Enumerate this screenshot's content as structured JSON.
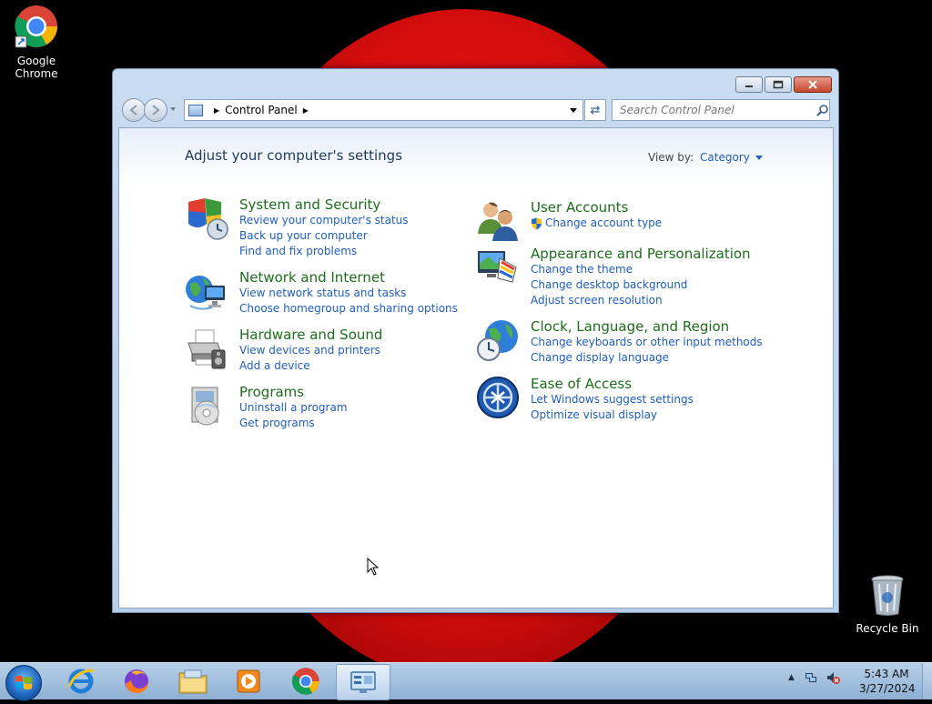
{
  "desktop": {
    "icons": [
      {
        "label_line1": "Google",
        "label_line2": "Chrome",
        "icon": "chrome-icon"
      },
      {
        "label": "Recycle Bin",
        "icon": "recycle-bin-icon"
      }
    ]
  },
  "window": {
    "address": {
      "breadcrumb": "Control Panel",
      "icon": "control-panel-icon"
    },
    "search": {
      "placeholder": "Search Control Panel"
    },
    "page_title": "Adjust your computer's settings",
    "view_by": {
      "label": "View by:",
      "value": "Category"
    },
    "categories": [
      {
        "title": "System and Security",
        "icon": "shield-icon",
        "links": [
          "Review your computer's status",
          "Back up your computer",
          "Find and fix problems"
        ]
      },
      {
        "title": "Network and Internet",
        "icon": "network-icon",
        "links": [
          "View network status and tasks",
          "Choose homegroup and sharing options"
        ]
      },
      {
        "title": "Hardware and Sound",
        "icon": "printer-icon",
        "links": [
          "View devices and printers",
          "Add a device"
        ]
      },
      {
        "title": "Programs",
        "icon": "programs-icon",
        "links": [
          "Uninstall a program",
          "Get programs"
        ]
      },
      {
        "title": "User Accounts",
        "icon": "users-icon",
        "links": [
          "Change account type"
        ]
      },
      {
        "title": "Appearance and Personalization",
        "icon": "monitor-palette-icon",
        "links": [
          "Change the theme",
          "Change desktop background",
          "Adjust screen resolution"
        ]
      },
      {
        "title": "Clock, Language, and Region",
        "icon": "globe-clock-icon",
        "links": [
          "Change keyboards or other input methods",
          "Change display language"
        ]
      },
      {
        "title": "Ease of Access",
        "icon": "ease-of-access-icon",
        "links": [
          "Let Windows suggest settings",
          "Optimize visual display"
        ]
      }
    ]
  },
  "taskbar": {
    "items": [
      "internet-explorer-icon",
      "firefox-icon",
      "file-explorer-icon",
      "media-player-icon",
      "chrome-icon",
      "control-panel-icon"
    ],
    "clock": {
      "time": "5:43 AM",
      "date": "3/27/2024"
    }
  },
  "colors": {
    "link": "#1e5ebf",
    "category_title": "#1c6d1c",
    "wallpaper_accent": "#e01010"
  }
}
